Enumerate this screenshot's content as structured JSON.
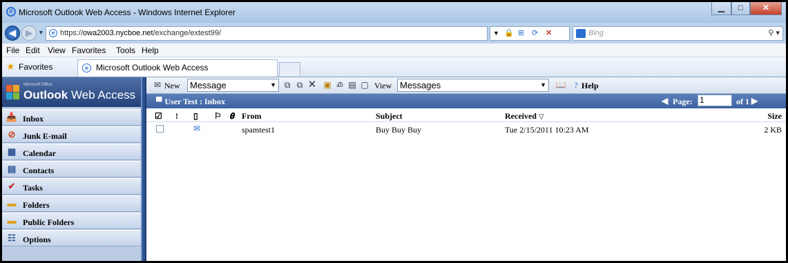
{
  "window": {
    "title": "Microsoft Outlook Web Access - Windows Internet Explorer"
  },
  "address": {
    "url_prefix": "https://",
    "url_domain": "owa2003.nycboe.net",
    "url_path": "/exchange/extest99/"
  },
  "search": {
    "placeholder": "Bing"
  },
  "menu": [
    "File",
    "Edit",
    "View",
    "Favorites",
    "Tools",
    "Help"
  ],
  "favorites": {
    "label": "Favorites",
    "tab_title": "Microsoft Outlook Web Access"
  },
  "brand": {
    "small": "Microsoft Office",
    "name_bold": "Outlook",
    "name_rest": " Web Access"
  },
  "nav": [
    {
      "label": "Inbox",
      "icon": "inbox-icon"
    },
    {
      "label": "Junk E-mail",
      "icon": "junk-email-icon"
    },
    {
      "label": "Calendar",
      "icon": "calendar-icon"
    },
    {
      "label": "Contacts",
      "icon": "contacts-icon"
    },
    {
      "label": "Tasks",
      "icon": "tasks-icon"
    },
    {
      "label": "Folders",
      "icon": "folder-icon"
    },
    {
      "label": "Public Folders",
      "icon": "public-folders-icon"
    },
    {
      "label": "Options",
      "icon": "options-icon"
    }
  ],
  "toolbar": {
    "new_label": "New",
    "new_select": "Message",
    "view_label": "View",
    "view_select": "Messages",
    "help_label": "Help"
  },
  "folder_header": {
    "title": "User Test : Inbox",
    "page_label": "Page:",
    "page_value": "1",
    "page_of": "of 1"
  },
  "columns": {
    "from": "From",
    "subject": "Subject",
    "received": "Received",
    "size": "Size"
  },
  "messages": [
    {
      "from": "spamtest1",
      "subject": "Buy Buy Buy",
      "received": "Tue 2/15/2011 10:23 AM",
      "size": "2 KB"
    }
  ],
  "colors": {
    "nav_blue": "#2b5394",
    "header_blue": "#3d62a0",
    "titlebar": "#b9d1ea"
  }
}
